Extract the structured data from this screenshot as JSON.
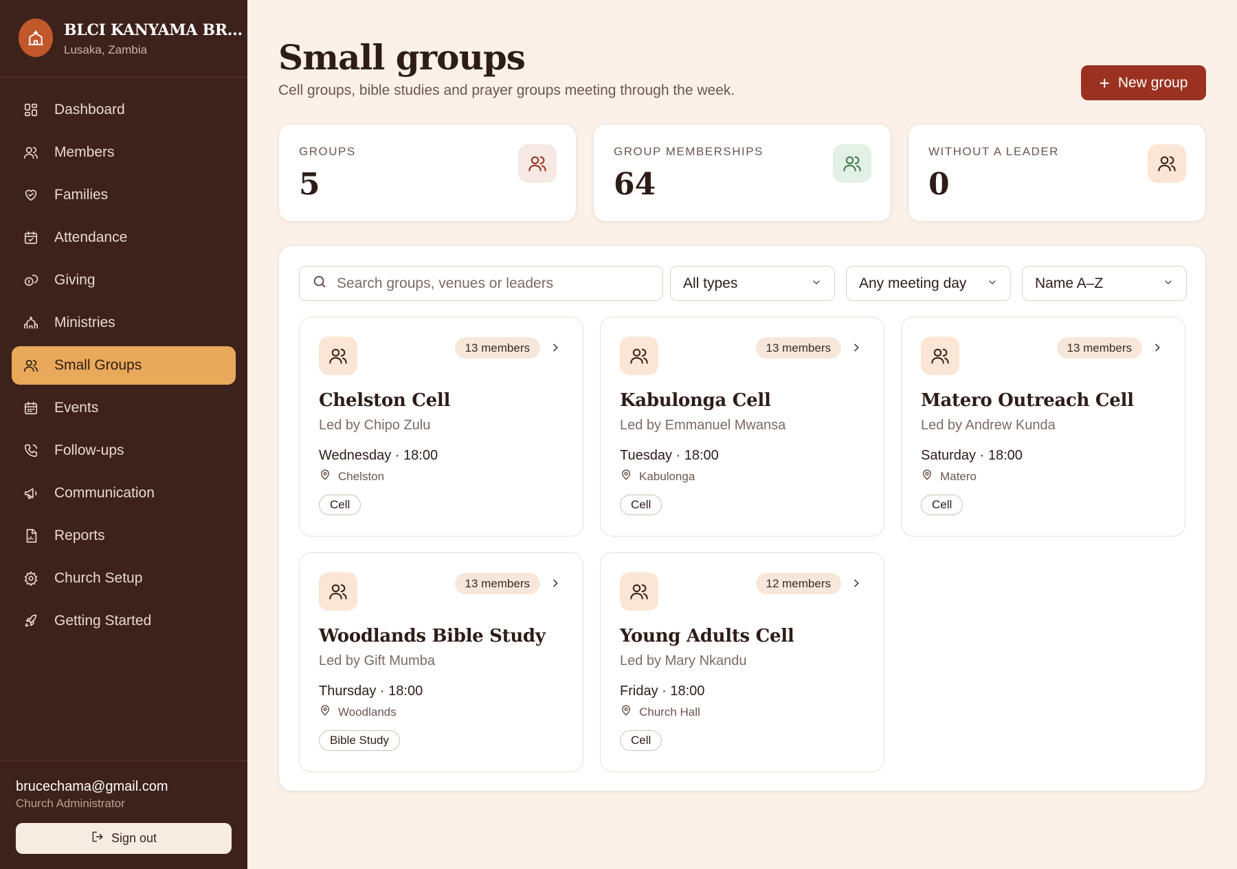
{
  "org": {
    "name": "BLCI KANYAMA BR...",
    "location": "Lusaka, Zambia"
  },
  "nav": [
    {
      "label": "Dashboard",
      "icon": "dashboard-icon"
    },
    {
      "label": "Members",
      "icon": "user-icon"
    },
    {
      "label": "Families",
      "icon": "heart-hand-icon"
    },
    {
      "label": "Attendance",
      "icon": "calendar-check-icon"
    },
    {
      "label": "Giving",
      "icon": "coins-icon"
    },
    {
      "label": "Ministries",
      "icon": "church-icon"
    },
    {
      "label": "Small Groups",
      "icon": "users-icon",
      "active": true
    },
    {
      "label": "Events",
      "icon": "calendar-icon"
    },
    {
      "label": "Follow-ups",
      "icon": "phone-icon"
    },
    {
      "label": "Communication",
      "icon": "megaphone-icon"
    },
    {
      "label": "Reports",
      "icon": "report-icon"
    },
    {
      "label": "Church Setup",
      "icon": "gear-icon"
    },
    {
      "label": "Getting Started",
      "icon": "rocket-icon"
    }
  ],
  "user": {
    "email": "brucechama@gmail.com",
    "role": "Church Administrator",
    "signout_label": "Sign out"
  },
  "header": {
    "title": "Small groups",
    "subtitle": "Cell groups, bible studies and prayer groups meeting through the week.",
    "new_button_label": "New group"
  },
  "stats": [
    {
      "label": "GROUPS",
      "value": "5",
      "icon_color": "#9b3221",
      "icon_bg": "#f6e9e4"
    },
    {
      "label": "GROUP MEMBERSHIPS",
      "value": "64",
      "icon_color": "#3f7a4d",
      "icon_bg": "#e3f0e6"
    },
    {
      "label": "WITHOUT A LEADER",
      "value": "0",
      "icon_color": "#3d221b",
      "icon_bg": "#fbe6d6"
    }
  ],
  "filters": {
    "search_placeholder": "Search groups, venues or leaders",
    "type_value": "All types",
    "day_value": "Any meeting day",
    "sort_value": "Name A–Z"
  },
  "groups": [
    {
      "name": "Chelston Cell",
      "leader": "Led by Chipo Zulu",
      "when": "Wednesday · 18:00",
      "venue": "Chelston",
      "type": "Cell",
      "members": "13 members"
    },
    {
      "name": "Kabulonga Cell",
      "leader": "Led by Emmanuel Mwansa",
      "when": "Tuesday · 18:00",
      "venue": "Kabulonga",
      "type": "Cell",
      "members": "13 members"
    },
    {
      "name": "Matero Outreach Cell",
      "leader": "Led by Andrew Kunda",
      "when": "Saturday · 18:00",
      "venue": "Matero",
      "type": "Cell",
      "members": "13 members"
    },
    {
      "name": "Woodlands Bible Study",
      "leader": "Led by Gift Mumba",
      "when": "Thursday · 18:00",
      "venue": "Woodlands",
      "type": "Bible Study",
      "members": "13 members"
    },
    {
      "name": "Young Adults Cell",
      "leader": "Led by Mary Nkandu",
      "when": "Friday · 18:00",
      "venue": "Church Hall",
      "type": "Cell",
      "members": "12 members"
    }
  ]
}
